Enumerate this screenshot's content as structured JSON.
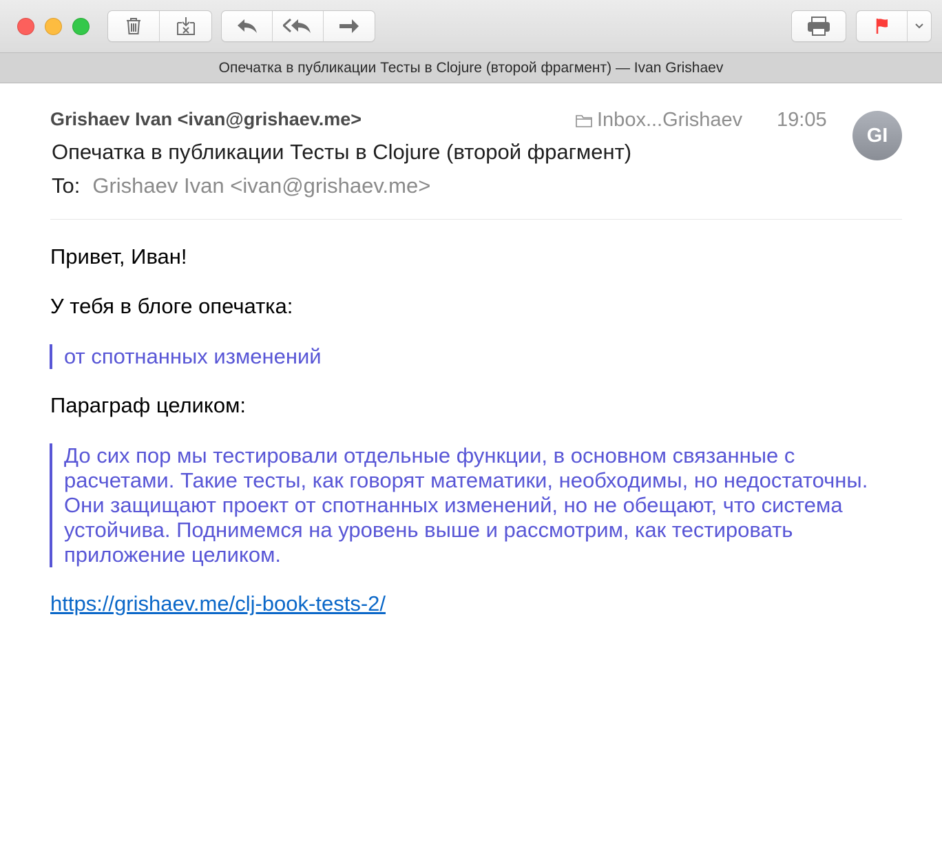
{
  "window": {
    "title": "Опечатка в публикации Тесты в Clojure (второй фрагмент) — Ivan Grishaev"
  },
  "toolbar": {
    "buttons": [
      "trash-icon",
      "junk-icon",
      "reply-icon",
      "reply-all-icon",
      "forward-icon",
      "print-icon",
      "flag-icon",
      "chevron-down-icon"
    ],
    "flag_color": "#fc3d39"
  },
  "message": {
    "sender": "Grishaev Ivan <ivan@grishaev.me>",
    "mailbox": "Inbox...Grishaev",
    "time": "19:05",
    "avatar_initials": "GI",
    "subject": "Опечатка в публикации Тесты в Clojure (второй фрагмент)",
    "to_label": "To:",
    "to_value": "Grishaev Ivan <ivan@grishaev.me>"
  },
  "body": {
    "greeting": "Привет, Иван!",
    "line1": "У тебя в блоге опечатка:",
    "quote1": "от спотнанных изменений",
    "line2": "Параграф целиком:",
    "quote2": "До сих пор мы тестировали отдельные функции, в основном связанные с расчетами. Такие тесты, как говорят математики, необходимы, но недостаточны. Они защищают проект от спотнанных изменений, но не обещают, что система устойчива. Поднимемся на уровень выше и рассмотрим, как тестировать приложение целиком.",
    "link": "https://grishaev.me/clj-book-tests-2/",
    "quote_color": "#5856d6",
    "link_color": "#0a67c8"
  }
}
